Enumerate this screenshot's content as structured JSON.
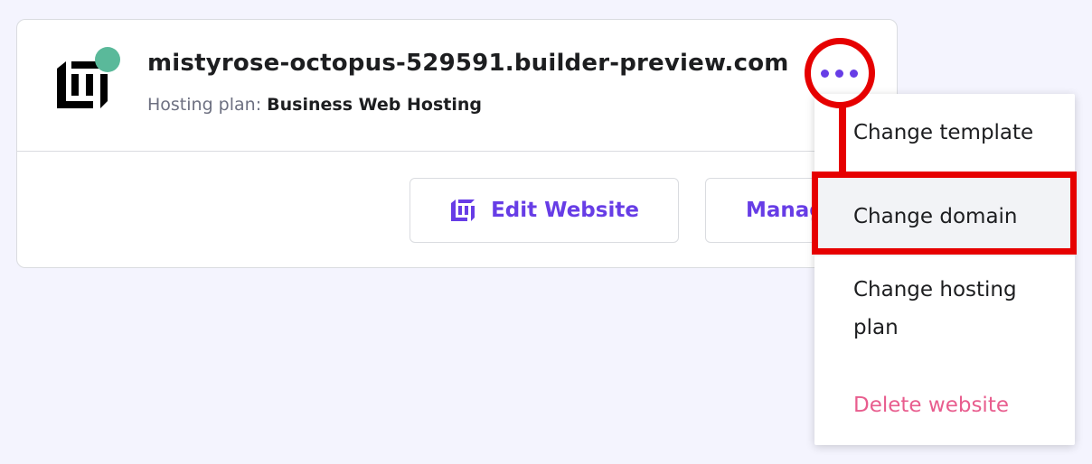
{
  "website": {
    "domain": "mistyrose-octopus-529591.builder-preview.com",
    "plan_label": "Hosting plan:",
    "plan_name": "Business Web Hosting",
    "status_color": "#5ab99a"
  },
  "actions": {
    "edit_label": "Edit Website",
    "manage_label": "Manage",
    "more_icon": "three-dots-icon"
  },
  "menu": {
    "change_template": "Change template",
    "change_domain": "Change domain",
    "change_hosting_plan": "Change hosting plan",
    "delete_website": "Delete website"
  },
  "colors": {
    "accent": "#673de6",
    "danger": "#e85d8e",
    "highlight": "#e60000",
    "background": "#f4f4fe"
  }
}
